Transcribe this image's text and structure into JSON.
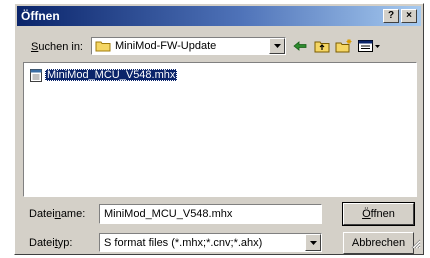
{
  "dialog": {
    "title": "Öffnen",
    "help_button": "?",
    "close_button": "×"
  },
  "lookin": {
    "label_underlined": "S",
    "label_rest": "uchen in:",
    "folder": "MiniMod-FW-Update"
  },
  "files": [
    {
      "name": "MiniMod_MCU_V548.mhx"
    }
  ],
  "filename": {
    "label_pre": "Datei",
    "label_underlined": "n",
    "label_post": "ame:",
    "value": "MiniMod_MCU_V548.mhx"
  },
  "filetype": {
    "label_pre": "Datei",
    "label_underlined": "t",
    "label_post": "yp:",
    "value": "S format files (*.mhx;*.cnv;*.ahx)"
  },
  "buttons": {
    "open_underlined": "Ö",
    "open_rest": "ffnen",
    "cancel": "Abbrechen"
  }
}
